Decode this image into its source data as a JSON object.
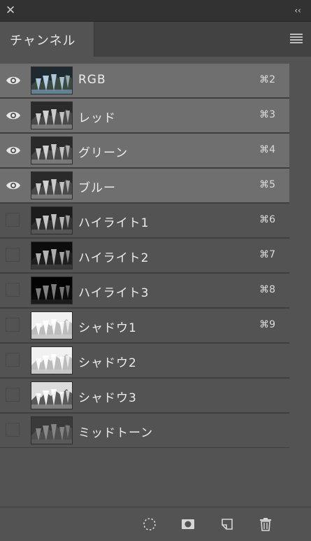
{
  "window": {
    "close_glyph": "✕",
    "collapse_glyph": "‹‹"
  },
  "panel": {
    "tab_label": "チャンネル",
    "menu_icon": "panel-menu-icon"
  },
  "channels": [
    {
      "label": "RGB",
      "shortcut": "⌘2",
      "visible": true,
      "selected": true,
      "thumb": "color"
    },
    {
      "label": "レッド",
      "shortcut": "⌘3",
      "visible": true,
      "selected": true,
      "thumb": "gray"
    },
    {
      "label": "グリーン",
      "shortcut": "⌘4",
      "visible": true,
      "selected": true,
      "thumb": "gray"
    },
    {
      "label": "ブルー",
      "shortcut": "⌘5",
      "visible": true,
      "selected": true,
      "thumb": "gray"
    },
    {
      "label": "ハイライト1",
      "shortcut": "⌘6",
      "visible": false,
      "selected": false,
      "thumb": "dark"
    },
    {
      "label": "ハイライト2",
      "shortcut": "⌘7",
      "visible": false,
      "selected": false,
      "thumb": "darker"
    },
    {
      "label": "ハイライト3",
      "shortcut": "⌘8",
      "visible": false,
      "selected": false,
      "thumb": "darkest"
    },
    {
      "label": "シャドウ1",
      "shortcut": "⌘9",
      "visible": false,
      "selected": false,
      "thumb": "light"
    },
    {
      "label": "シャドウ2",
      "shortcut": "",
      "visible": false,
      "selected": false,
      "thumb": "light"
    },
    {
      "label": "シャドウ3",
      "shortcut": "",
      "visible": false,
      "selected": false,
      "thumb": "lightgray"
    },
    {
      "label": "ミッドトーン",
      "shortcut": "",
      "visible": false,
      "selected": false,
      "thumb": "mid"
    }
  ],
  "footer": {
    "buttons": [
      {
        "name": "load-selection-icon"
      },
      {
        "name": "save-selection-icon"
      },
      {
        "name": "new-channel-icon"
      },
      {
        "name": "delete-channel-icon"
      }
    ]
  },
  "colors": {
    "panel_bg": "#535353",
    "selected_row_bg": "#6f6f6f",
    "text": "#ececec"
  }
}
